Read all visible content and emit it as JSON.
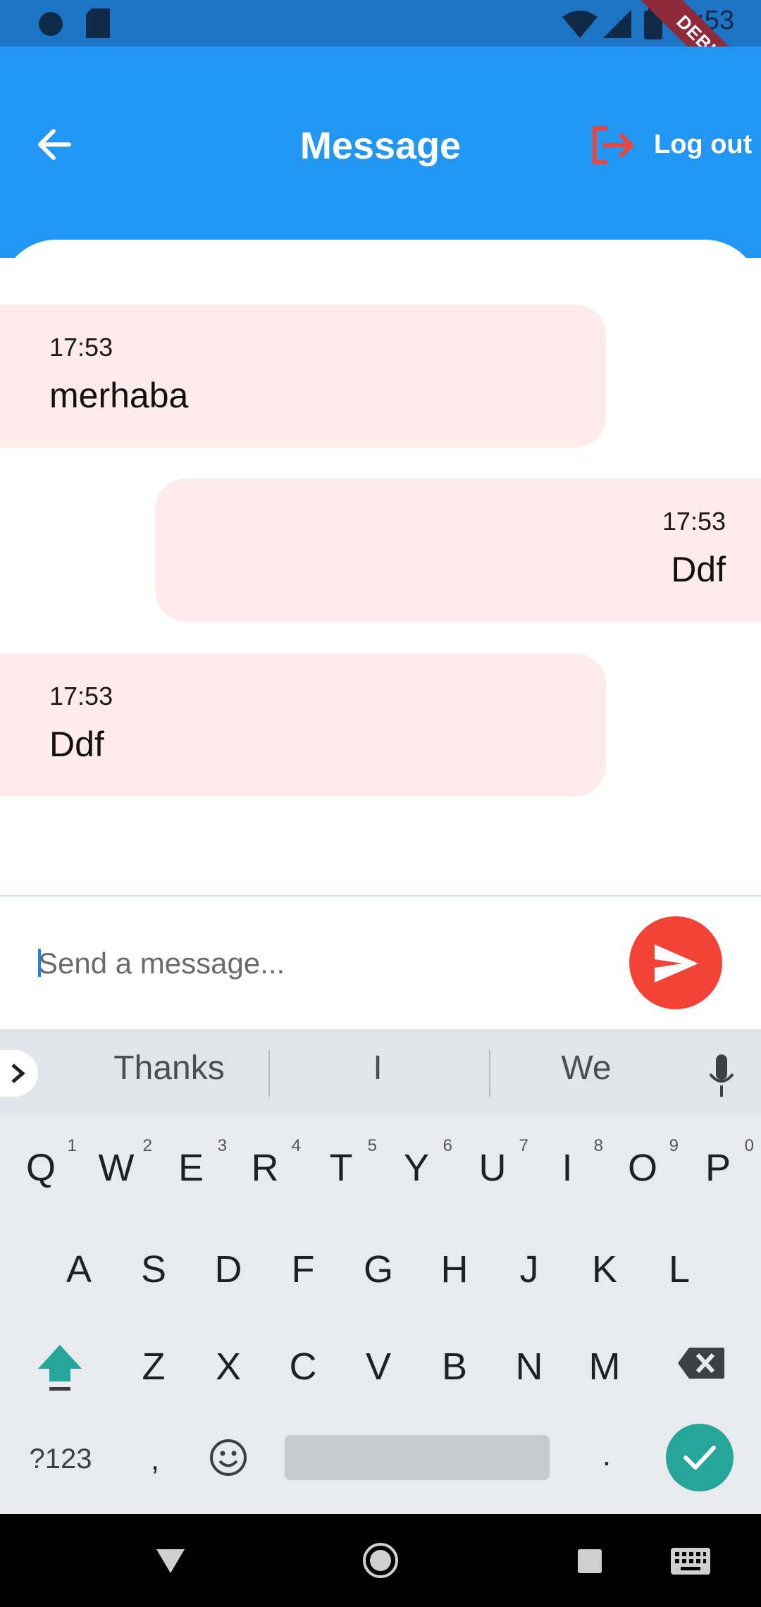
{
  "status_bar": {
    "time": "5:53",
    "debug_label": "DEBUG"
  },
  "app_bar": {
    "title": "Message",
    "logout_label": "Log out"
  },
  "messages": [
    {
      "time": "17:53",
      "text": "merhaba",
      "side": "left"
    },
    {
      "time": "17:53",
      "text": "Ddf",
      "side": "right"
    },
    {
      "time": "17:53",
      "text": "Ddf",
      "side": "left"
    }
  ],
  "composer": {
    "placeholder": "Send a message..."
  },
  "keyboard": {
    "suggestions": [
      "Thanks",
      "I",
      "We"
    ],
    "row1": [
      {
        "key": "Q",
        "alt": "1"
      },
      {
        "key": "W",
        "alt": "2"
      },
      {
        "key": "E",
        "alt": "3"
      },
      {
        "key": "R",
        "alt": "4"
      },
      {
        "key": "T",
        "alt": "5"
      },
      {
        "key": "Y",
        "alt": "6"
      },
      {
        "key": "U",
        "alt": "7"
      },
      {
        "key": "I",
        "alt": "8"
      },
      {
        "key": "O",
        "alt": "9"
      },
      {
        "key": "P",
        "alt": "0"
      }
    ],
    "row2": [
      "A",
      "S",
      "D",
      "F",
      "G",
      "H",
      "J",
      "K",
      "L"
    ],
    "row3": [
      "Z",
      "X",
      "C",
      "V",
      "B",
      "N",
      "M"
    ],
    "symbols_key": "?123",
    "comma_key": ",",
    "period_key": "."
  },
  "colors": {
    "app_bar": "#2196f3",
    "bubble": "#ffecea",
    "send_button": "#f44336",
    "logout_icon": "#f44336",
    "done_key": "#26a69a"
  },
  "icons": {
    "back": "arrow-left-icon",
    "logout": "logout-icon",
    "send": "send-icon",
    "mic": "mic-icon",
    "shift": "shift-icon",
    "backspace": "backspace-icon",
    "emoji": "emoji-icon",
    "done": "check-icon"
  }
}
